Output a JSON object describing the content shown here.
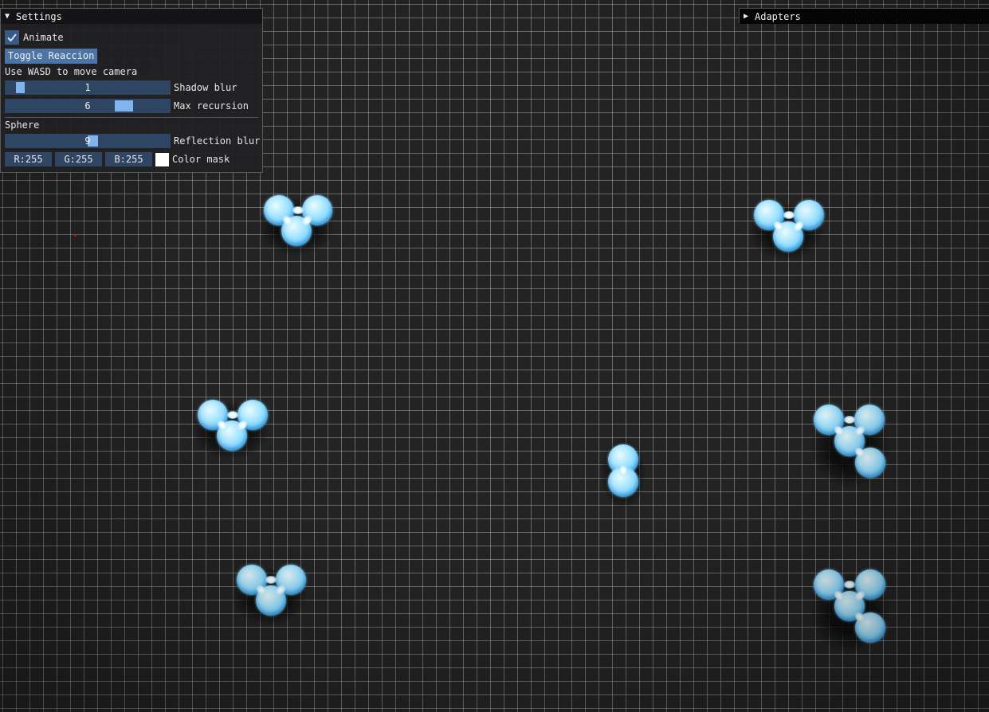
{
  "settings": {
    "title": "Settings",
    "animate_label": "Animate",
    "animate_checked": true,
    "toggle_button": "Toggle Reaccion",
    "hint": "Use WASD to move camera",
    "shadow_blur": {
      "value": "1",
      "label": "Shadow blur"
    },
    "max_recursion": {
      "value": "6",
      "label": "Max recursion"
    },
    "section_title": "Sphere",
    "reflection_blur": {
      "value": "9",
      "label": "Reflection blur"
    },
    "color": {
      "r": "R:255",
      "g": "G:255",
      "b": "B:255",
      "label": "Color mask",
      "swatch": "#ffffff"
    }
  },
  "adapters": {
    "title": "Adapters",
    "collapsed": true
  },
  "icons": {
    "settings_arrow": "triangle-down-icon",
    "adapters_arrow": "triangle-right-icon",
    "check": "checkmark-icon"
  },
  "colors": {
    "accent": "#4c74a6",
    "slider_bg": "#2e4564",
    "grab": "#7fb4ec",
    "sphere": "#8fdcff",
    "background": "#232323"
  }
}
